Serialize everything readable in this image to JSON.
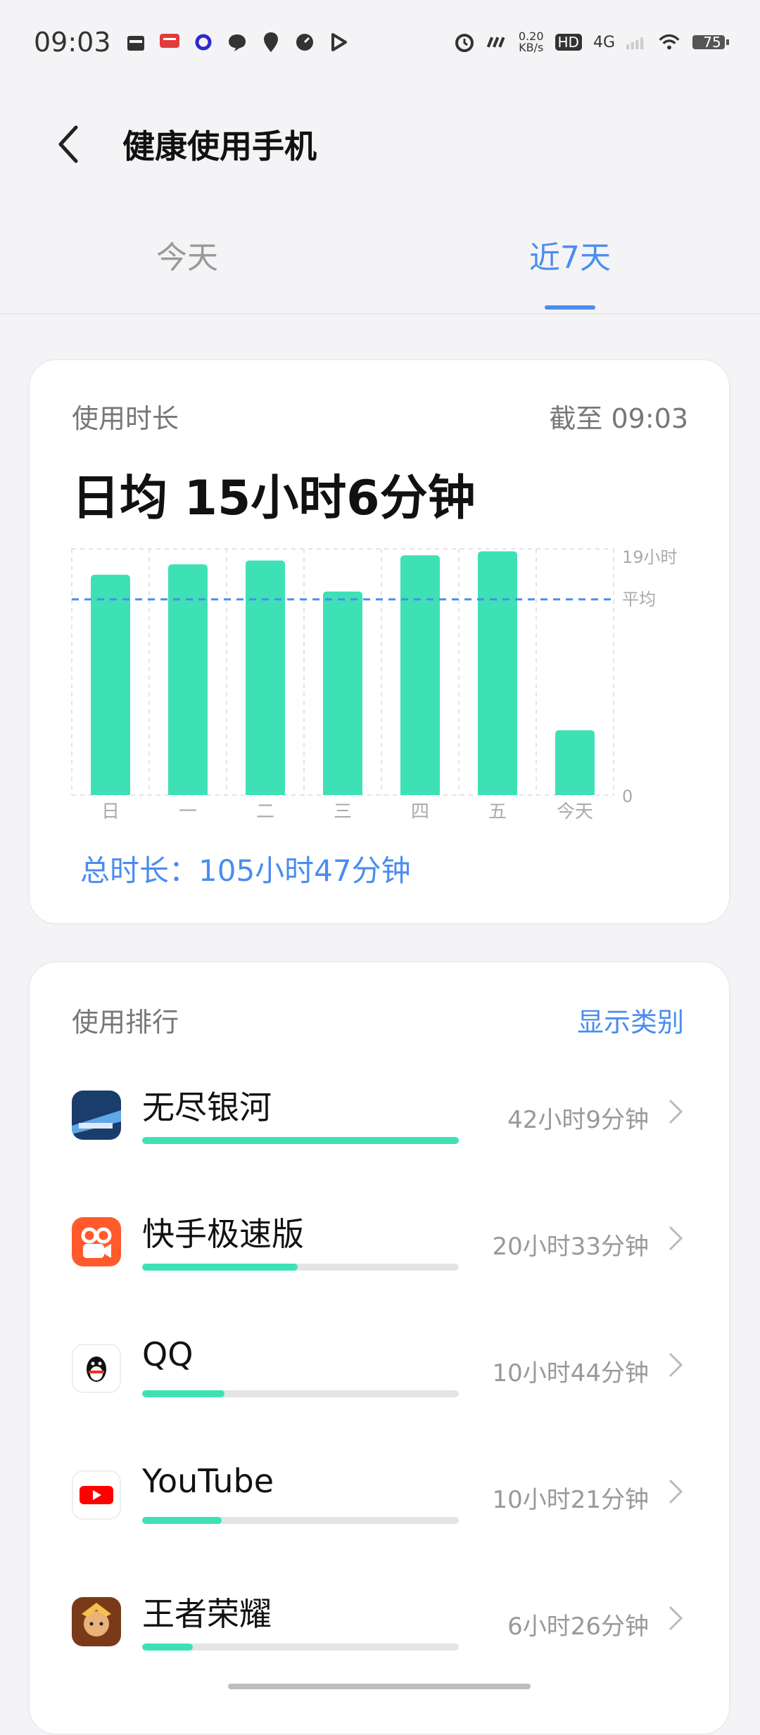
{
  "status_bar": {
    "time": "09:03",
    "net_speed_value": "0.20",
    "net_speed_unit": "KB/s",
    "hd": "HD",
    "network": "4G",
    "battery": "75",
    "icons": [
      "calendar-icon",
      "notification-icon",
      "circle-icon",
      "chat-icon",
      "location-icon",
      "speed-icon",
      "play-icon",
      "alarm-icon",
      "carrier-icon",
      "wifi-icon",
      "battery-icon"
    ]
  },
  "header": {
    "title": "健康使用手机"
  },
  "tabs": [
    {
      "label": "今天",
      "active": false
    },
    {
      "label": "近7天",
      "active": true
    }
  ],
  "usage_card": {
    "label": "使用时长",
    "as_of": "截至 09:03",
    "daily_average": "日均 15小时6分钟",
    "total": "总时长：105小时47分钟"
  },
  "chart_data": {
    "type": "bar",
    "categories": [
      "日",
      "一",
      "二",
      "三",
      "四",
      "五",
      "今天"
    ],
    "values": [
      17,
      17.8,
      18.1,
      15.7,
      18.5,
      18.8,
      5
    ],
    "ylim": [
      0,
      19
    ],
    "y_ticks": [
      "0",
      "19小时"
    ],
    "average": 15.1,
    "average_label": "平均",
    "bar_color": "#3ee1b6",
    "average_line_color": "#4a8df0",
    "grid": true
  },
  "ranking": {
    "title": "使用排行",
    "toggle_label": "显示类别",
    "apps": [
      {
        "name": "无尽银河",
        "time": "42小时9分钟",
        "fraction": 1.0,
        "icon": "endless-galaxy-icon"
      },
      {
        "name": "快手极速版",
        "time": "20小时33分钟",
        "fraction": 0.49,
        "icon": "kuaishou-icon"
      },
      {
        "name": "QQ",
        "time": "10小时44分钟",
        "fraction": 0.26,
        "icon": "qq-icon"
      },
      {
        "name": "YouTube",
        "time": "10小时21分钟",
        "fraction": 0.25,
        "icon": "youtube-icon"
      },
      {
        "name": "王者荣耀",
        "time": "6小时26分钟",
        "fraction": 0.16,
        "icon": "honor-of-kings-icon"
      }
    ]
  },
  "colors": {
    "accent": "#4a8df0",
    "bar": "#3ee1b6"
  }
}
